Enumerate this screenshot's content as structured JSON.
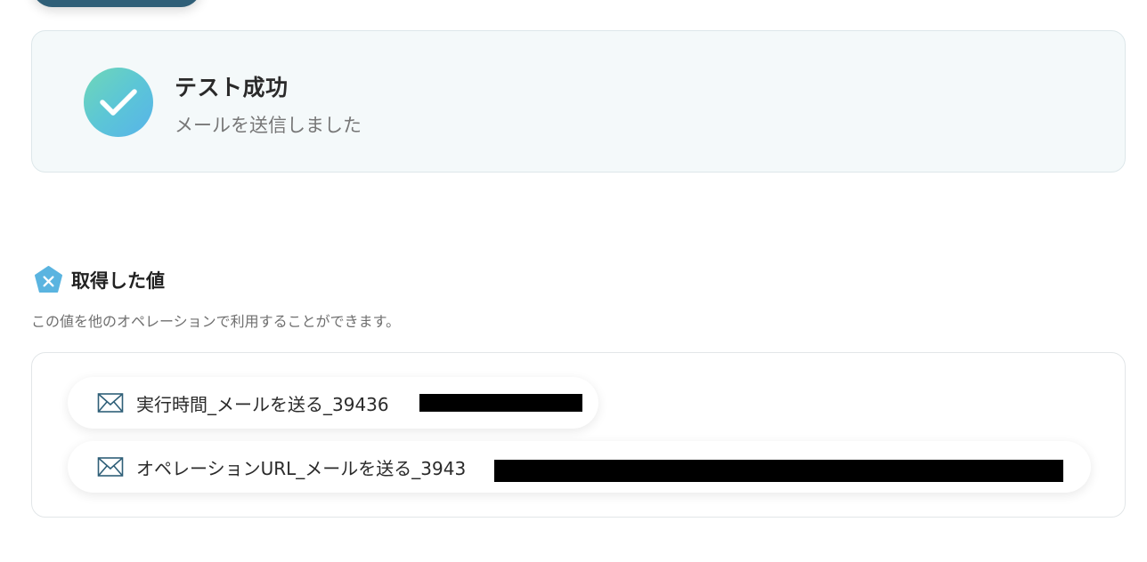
{
  "success": {
    "title": "テスト成功",
    "message": "メールを送信しました"
  },
  "values_section": {
    "title": "取得した値",
    "description": "この値を他のオペレーションで利用することができます。",
    "items": [
      {
        "label": "実行時間_メールを送る_39436",
        "icon": "mail-icon"
      },
      {
        "label": "オペレーションURL_メールを送る_3943",
        "icon": "mail-icon"
      }
    ]
  },
  "colors": {
    "success_bg": "#f4f9fa",
    "check_gradient_start": "#6fd7b7",
    "check_gradient_end": "#57b3ea",
    "top_button": "#2f5f78",
    "pentagon": "#5ab4e0",
    "mail_icon": "#2f5f78"
  }
}
